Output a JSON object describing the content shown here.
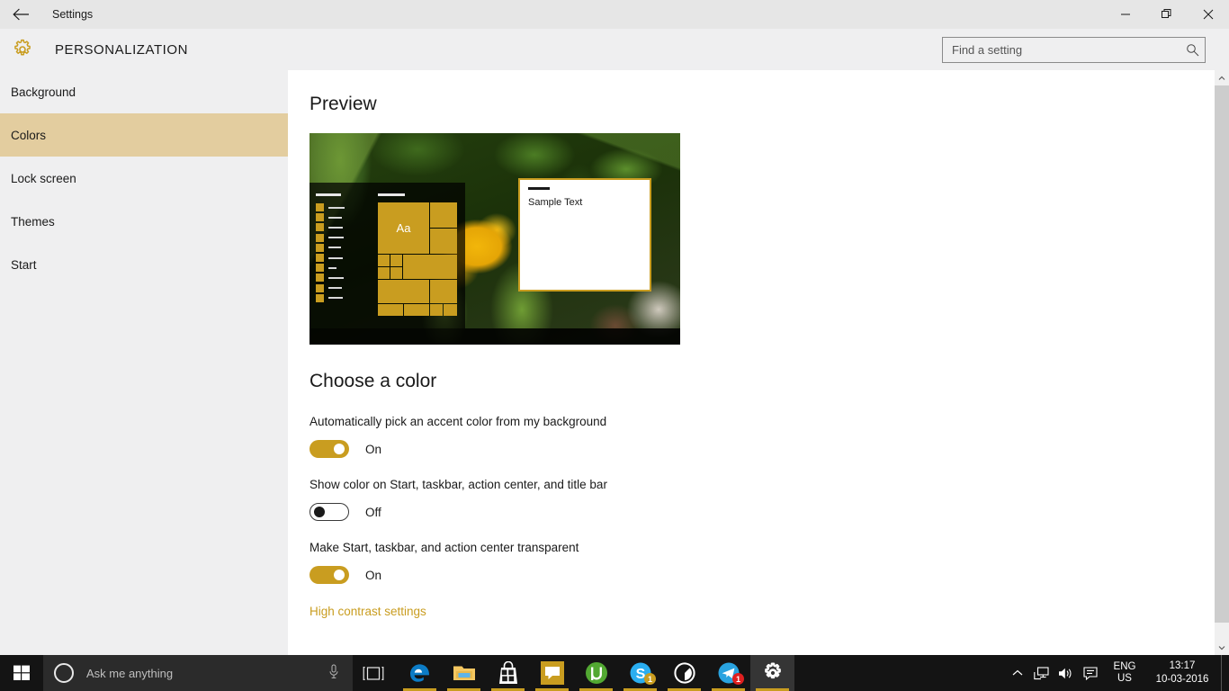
{
  "window": {
    "title": "Settings",
    "back_label": "Back",
    "minimize_label": "Minimize",
    "restore_label": "Restore",
    "close_label": "Close"
  },
  "header": {
    "page_title": "PERSONALIZATION",
    "gear_icon": "gear-icon"
  },
  "search": {
    "placeholder": "Find a setting",
    "value": "",
    "icon": "search-icon"
  },
  "sidebar": {
    "items": [
      {
        "label": "Background",
        "selected": false
      },
      {
        "label": "Colors",
        "selected": true
      },
      {
        "label": "Lock screen",
        "selected": false
      },
      {
        "label": "Themes",
        "selected": false
      },
      {
        "label": "Start",
        "selected": false
      }
    ]
  },
  "main": {
    "preview_heading": "Preview",
    "choose_heading": "Choose a color",
    "preview": {
      "tile_text": "Aa",
      "sample_window_text": "Sample Text"
    },
    "settings": [
      {
        "label": "Automatically pick an accent color from my background",
        "state": "On",
        "on": true
      },
      {
        "label": "Show color on Start, taskbar, action center, and title bar",
        "state": "Off",
        "on": false
      },
      {
        "label": "Make Start, taskbar, and action center transparent",
        "state": "On",
        "on": true
      }
    ],
    "link": "High contrast settings"
  },
  "colors": {
    "accent": "#c99d20",
    "selected_nav": "#e3cd9f",
    "link": "#c99d20",
    "window_chrome": "#e6e6e6",
    "content_bg": "#ffffff",
    "taskbar": "#141414"
  },
  "taskbar": {
    "start_label": "Start",
    "cortana_placeholder": "Ask me anything",
    "mic_icon": "microphone-icon",
    "taskview_label": "Task View",
    "apps": [
      {
        "name": "edge",
        "label": "Microsoft Edge",
        "running": true,
        "badge": ""
      },
      {
        "name": "file-explorer",
        "label": "File Explorer",
        "running": true,
        "badge": ""
      },
      {
        "name": "store",
        "label": "Store",
        "running": true,
        "badge": ""
      },
      {
        "name": "messaging",
        "label": "Messaging",
        "running": true,
        "badge": ""
      },
      {
        "name": "utorrent",
        "label": "uTorrent",
        "running": true,
        "badge": ""
      },
      {
        "name": "skype",
        "label": "Skype",
        "running": true,
        "badge": "1"
      },
      {
        "name": "opera",
        "label": "Opera",
        "running": true,
        "badge": ""
      },
      {
        "name": "telegram",
        "label": "Telegram",
        "running": true,
        "badge": "1"
      },
      {
        "name": "settings",
        "label": "Settings",
        "running": true,
        "badge": ""
      }
    ],
    "tray": {
      "chevron_icon": "chevron-up-icon",
      "network_icon": "network-icon",
      "volume_icon": "volume-icon",
      "action_center_icon": "action-center-icon",
      "language_line1": "ENG",
      "language_line2": "US",
      "time": "13:17",
      "date": "10-03-2016"
    }
  },
  "scrollbar": {
    "up_icon": "scroll-up-icon",
    "down_icon": "scroll-down-icon",
    "thumb": "scroll-thumb"
  }
}
